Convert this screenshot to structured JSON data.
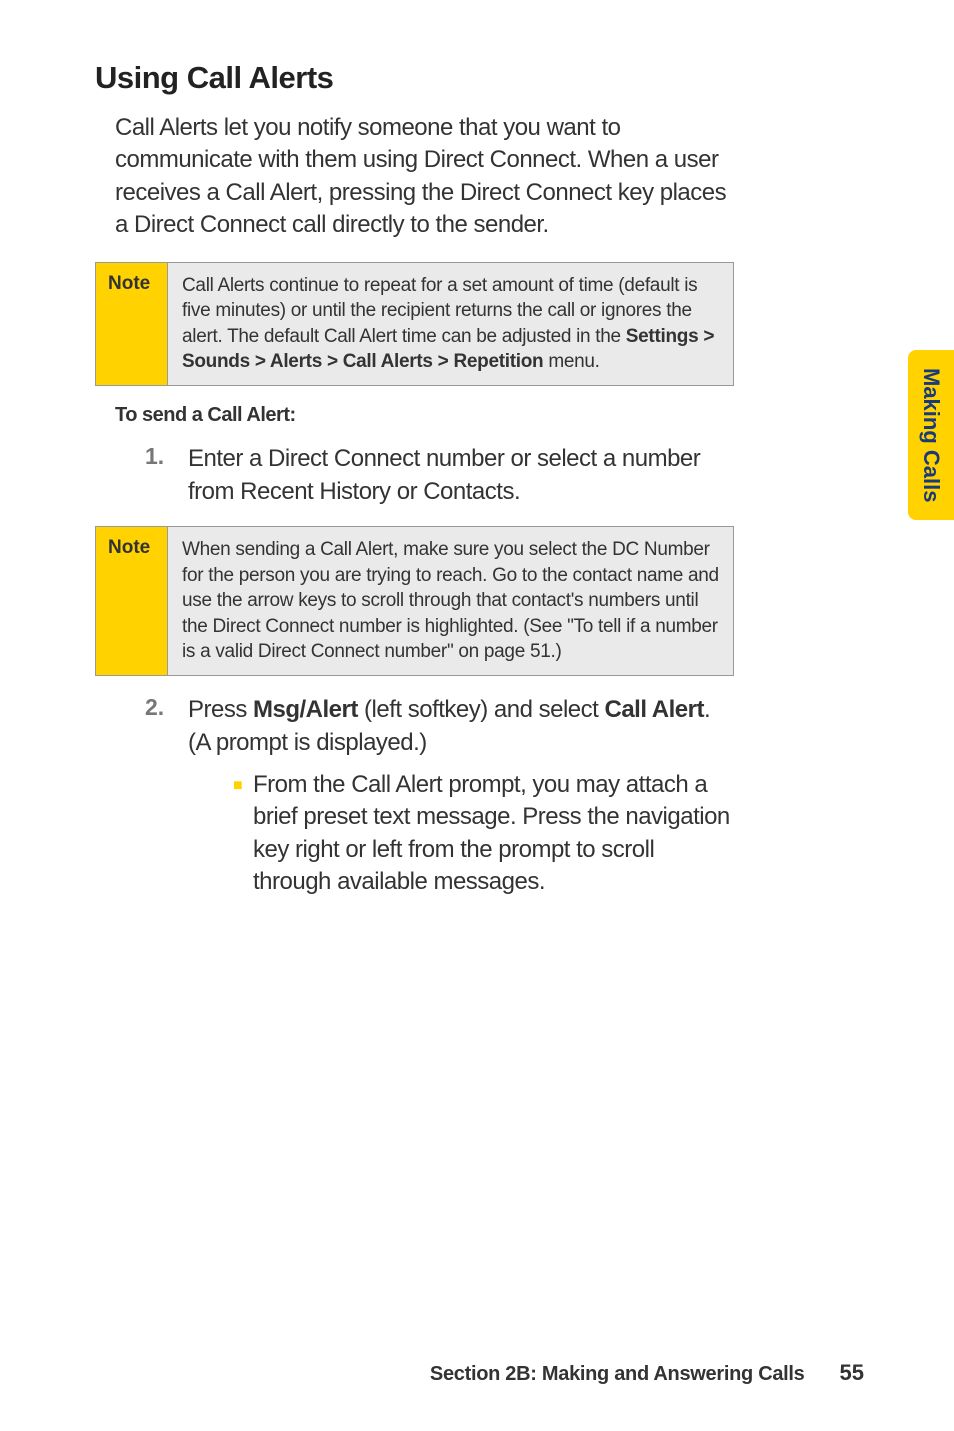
{
  "heading": "Using Call Alerts",
  "intro": "Call Alerts let you notify someone that you want to communicate with them using Direct Connect. When a user receives a Call Alert, pressing the Direct Connect key places a Direct Connect call directly to the sender.",
  "note1": {
    "label": "Note",
    "text_before": "Call Alerts continue to repeat for a set amount of time (default is five minutes) or until the recipient returns the call or ignores the alert. The default Call Alert time can be adjusted in the ",
    "text_bold": "Settings > Sounds > Alerts > Call Alerts > Repetition",
    "text_after": " menu."
  },
  "subheading": "To send a Call Alert:",
  "step1": {
    "number": "1.",
    "text": "Enter a Direct Connect number or select a number from Recent History or Contacts."
  },
  "note2": {
    "label": "Note",
    "text": "When sending a Call Alert, make sure you select the DC Number for the person you are trying to reach. Go to the contact name and use the arrow keys to scroll through that contact's numbers until the Direct Connect number is highlighted. (See \"To tell if a number is a valid Direct Connect number\" on page 51.)"
  },
  "step2": {
    "number": "2.",
    "text_before": "Press ",
    "text_bold1": "Msg/Alert",
    "text_mid": " (left softkey) and select ",
    "text_bold2": "Call Alert",
    "text_after": ". (A prompt is displayed.)"
  },
  "bullet1": "From the Call Alert prompt, you may attach a brief preset text message. Press the navigation key right or left from the prompt to scroll through available messages.",
  "sideTab": "Making Calls",
  "footer": {
    "section": "Section 2B: Making and Answering Calls",
    "page": "55"
  }
}
